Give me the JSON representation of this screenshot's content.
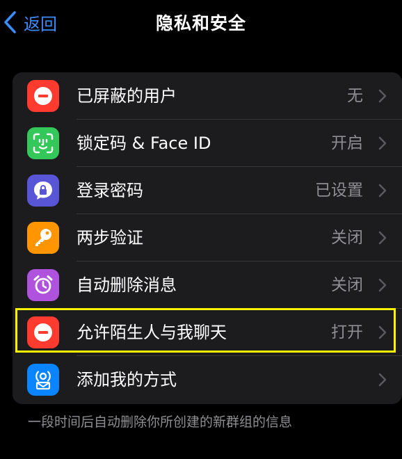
{
  "nav": {
    "back_label": "返回",
    "title": "隐私和安全"
  },
  "rows": [
    {
      "label": "已屏蔽的用户",
      "value": "无",
      "icon": "minus-circle-icon",
      "icon_color": "#ff3b30"
    },
    {
      "label": "锁定码 & Face ID",
      "value": "开启",
      "icon": "face-id-icon",
      "icon_color": "#34c759"
    },
    {
      "label": "登录密码",
      "value": "已设置",
      "icon": "lock-bubble-icon",
      "icon_color": "#5856d6"
    },
    {
      "label": "两步验证",
      "value": "关闭",
      "icon": "key-icon",
      "icon_color": "#ff9500"
    },
    {
      "label": "自动删除消息",
      "value": "关闭",
      "icon": "alarm-clock-icon",
      "icon_color": "#af52de"
    },
    {
      "label": "允许陌生人与我聊天",
      "value": "打开",
      "icon": "minus-circle-icon",
      "icon_color": "#ff3b30"
    },
    {
      "label": "添加我的方式",
      "value": "",
      "icon": "contact-broadcast-icon",
      "icon_color": "#0a84ff"
    }
  ],
  "footnote": "一段时间后自动删除你所创建的新群组的信息",
  "colors": {
    "accent": "#3b8cff",
    "highlight": "#fff200"
  }
}
